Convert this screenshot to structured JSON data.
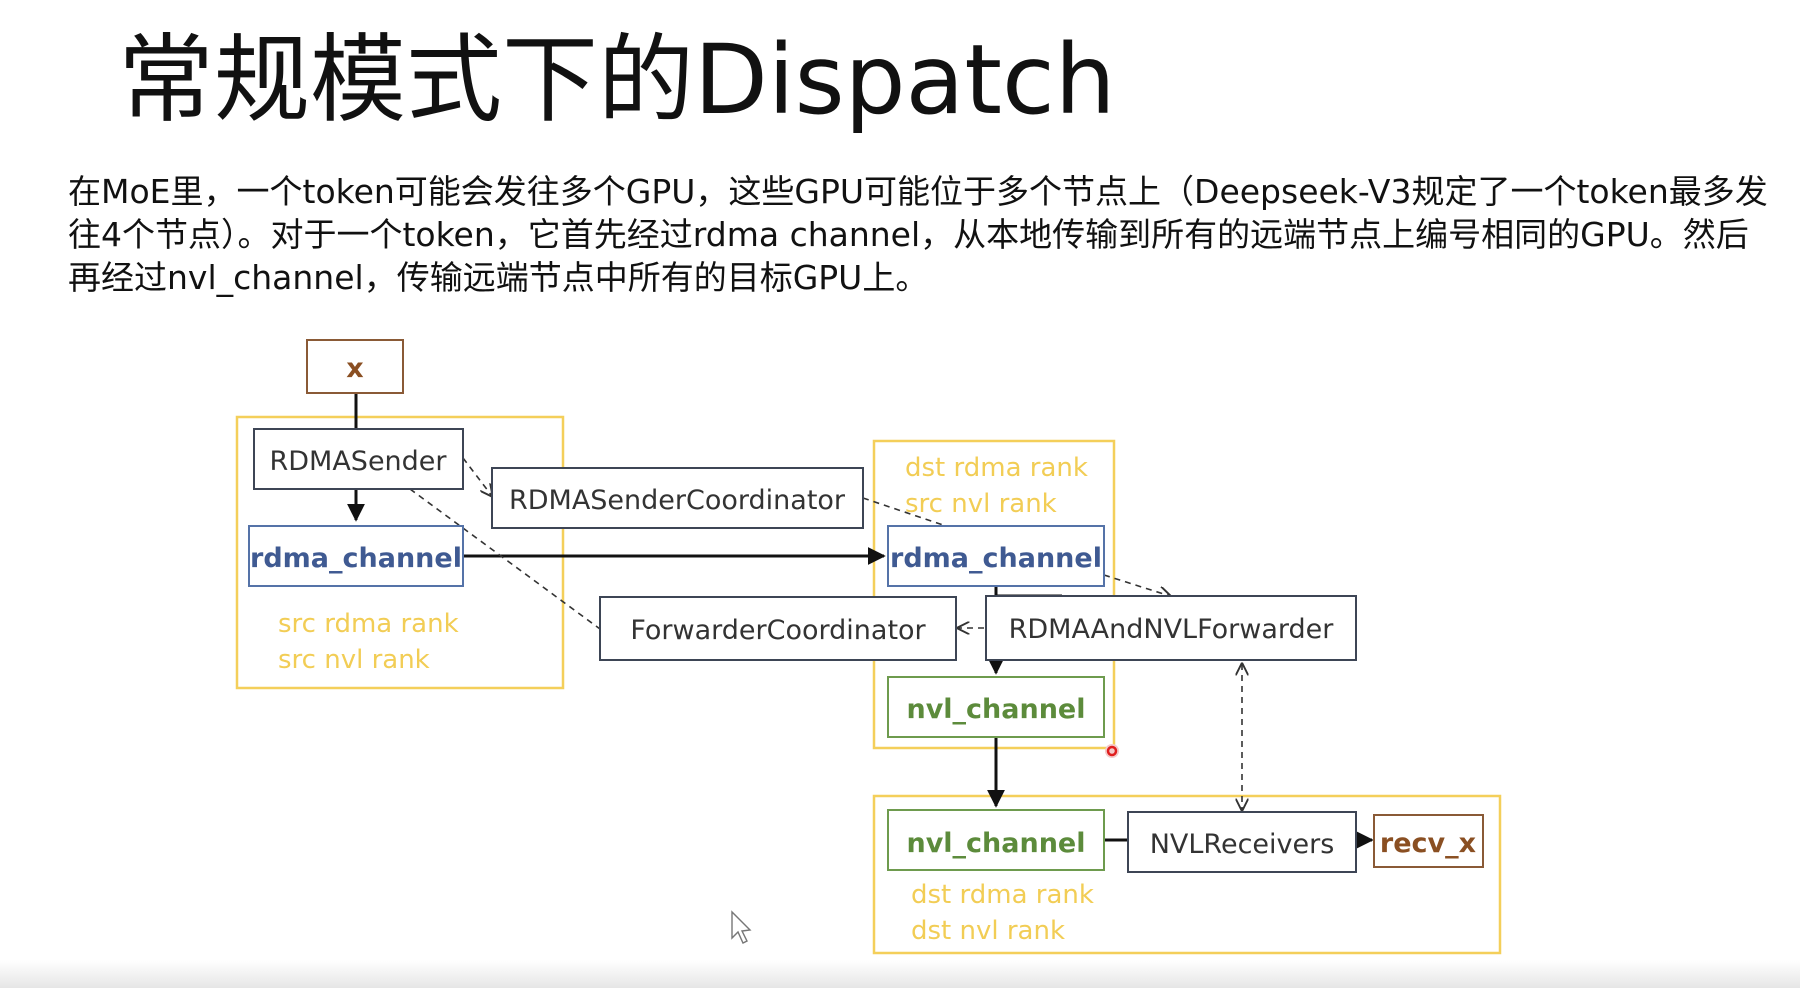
{
  "slide": {
    "title": "常规模式下的Dispatch",
    "body": "在MoE里，一个token可能会发往多个GPU，这些GPU可能位于多个节点上（Deepseek-V3规定了一个token最多发往4个节点）。对于一个token，它首先经过rdma channel，从本地传输到所有的远端节点上编号相同的GPU。然后再经过nvl_channel，传输远端节点中所有的目标GPU上。"
  },
  "diagram": {
    "nodes": {
      "x": "x",
      "rdma_sender": "RDMASender",
      "rdma_sender_coordinator": "RDMASenderCoordinator",
      "rdma_channel_src": "rdma_channel",
      "rdma_channel_dst": "rdma_channel",
      "forwarder_coordinator": "ForwarderCoordinator",
      "rdma_and_nvl_forwarder": "RDMAAndNVLForwarder",
      "nvl_channel_forward": "nvl_channel",
      "nvl_channel_recv": "nvl_channel",
      "nvl_receivers": "NVLReceivers",
      "recv_x": "recv_x"
    },
    "notes": {
      "src_group_1": "src rdma rank",
      "src_group_2": "src nvl rank",
      "forward_group_1": "dst rdma rank",
      "forward_group_2": "src nvl rank",
      "recv_group_1": "dst rdma rank",
      "recv_group_2": "dst nvl rank"
    },
    "colors": {
      "group_border": "#f4cf5a",
      "note_text": "#f2cd55",
      "rdma_channel": "#3f5a92",
      "nvl_channel": "#5c8b3b",
      "io_node": "#8a4f22"
    }
  }
}
